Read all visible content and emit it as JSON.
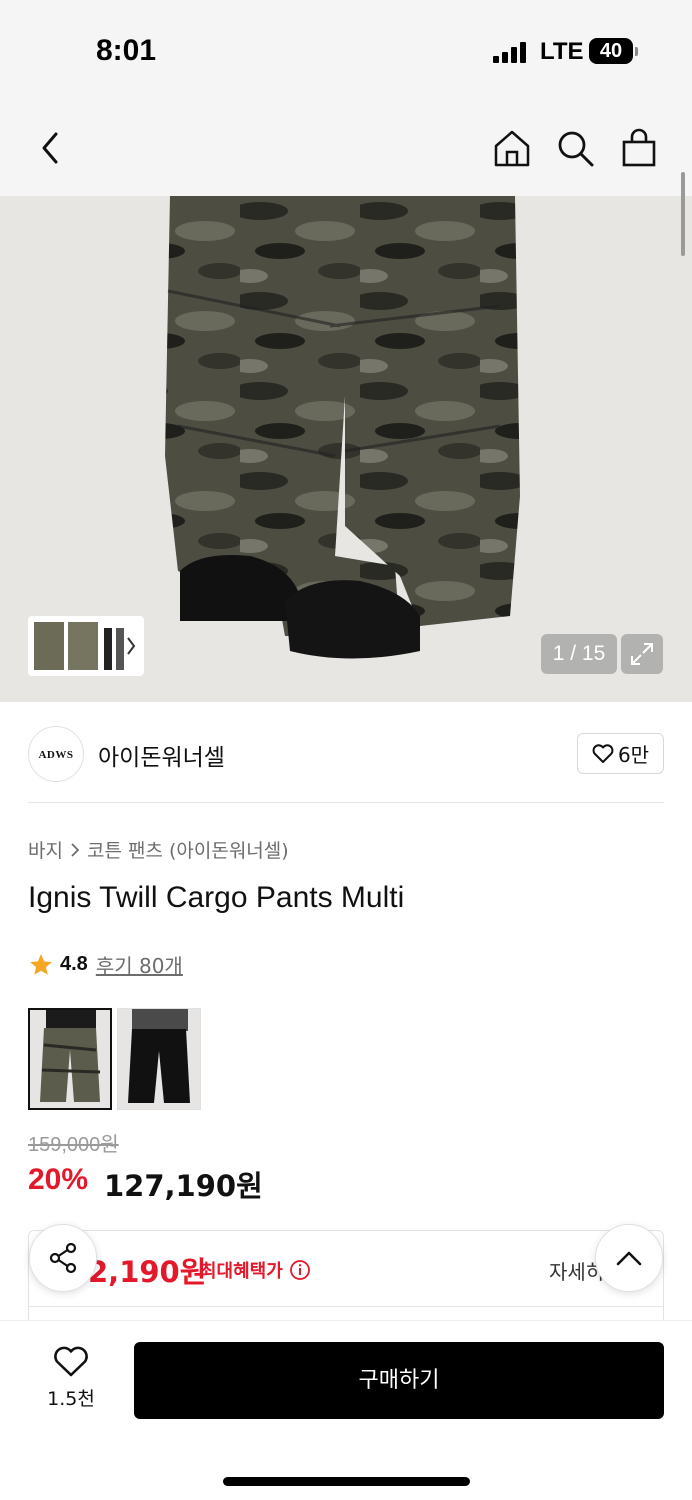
{
  "status_bar": {
    "time": "8:01",
    "network": "LTE",
    "battery": "40"
  },
  "nav": {
    "icons": [
      "chevron-left-icon",
      "home-icon",
      "search-icon",
      "shopping-bag-icon"
    ]
  },
  "gallery": {
    "counter": "1 / 15",
    "expand_icon": "expand-icon",
    "thumbnail_arrow": "chevron-right-icon"
  },
  "brand": {
    "logo_text": "ADWS",
    "name": "아이돈워너셀",
    "likes": "6만"
  },
  "product": {
    "breadcrumb": [
      "바지",
      "코튼 팬츠 (아이돈워너셀)"
    ],
    "title": "Ignis Twill Cargo Pants Multi",
    "rating": "4.8",
    "reviews": "후기 80개",
    "options": [
      {
        "name": "camo",
        "selected": true
      },
      {
        "name": "black",
        "selected": false
      }
    ],
    "original_price": "159,000원",
    "discount": "20%",
    "sale_price": "127,190원"
  },
  "benefit": {
    "price": "2,190원",
    "label": "최대혜택가",
    "detail_link": "자세히"
  },
  "bottom_bar": {
    "wish_count": "1.5천",
    "buy_label": "구매하기"
  },
  "colors": {
    "accent_red": "#e3182a",
    "buy_button": "#000000"
  }
}
